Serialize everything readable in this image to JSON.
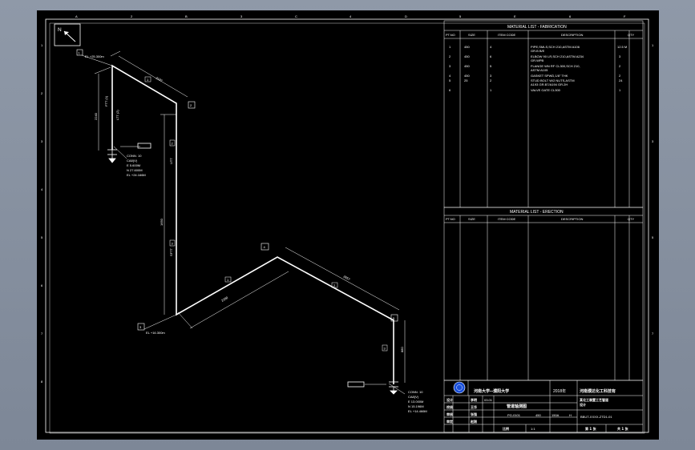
{
  "grid": {
    "top_letters": [
      "A",
      "B",
      "C",
      "D",
      "E",
      "F",
      "G",
      "H"
    ],
    "top_numbers": [
      "1",
      "2",
      "3",
      "4",
      "5",
      "6",
      "7",
      "8"
    ],
    "side_numbers": [
      "1",
      "2",
      "3",
      "4",
      "5",
      "6",
      "7",
      "8"
    ]
  },
  "north_arrow": "N",
  "fabrication": {
    "title": "MATERIAL LIST - FABRICATION",
    "headers": [
      "PT.NO",
      "SIZE",
      "ITEM CODE",
      "DESCRIPTION",
      "QTY"
    ],
    "rows": [
      {
        "pt": "1",
        "size": "450",
        "code": "4",
        "desc": "PIPE,SMLS,SCH 210,ASTM A106",
        "desc2": "GR.B B/E",
        "qty": "12.5 M"
      },
      {
        "pt": "2",
        "size": "450",
        "code": "6",
        "desc": "ELBOW 90 LR,SCH 210,ASTM A234",
        "desc2": "GR.WPB",
        "qty": "3"
      },
      {
        "pt": "3",
        "size": "450",
        "code": "5",
        "desc": "FLANGE WN RF CL300,SCH 210,",
        "desc2": "ASTM A105",
        "qty": "2"
      },
      {
        "pt": "4",
        "size": "450",
        "code": "3",
        "desc": "GASKET SPWD,1/8\" THK",
        "desc2": "",
        "qty": "2"
      },
      {
        "pt": "5",
        "size": "25",
        "code": "2",
        "desc": "STUD BOLT W/2 NUTS,ASTM",
        "desc2": "A193 GR.B7/A194 GR.2H",
        "qty": "24"
      },
      {
        "pt": "6",
        "size": "",
        "code": "1",
        "desc": "VALVE GATE CL300",
        "desc2": "",
        "qty": "1"
      }
    ]
  },
  "erection": {
    "title": "MATERIAL LIST - ERECTION",
    "headers": [
      "PT.NO",
      "SIZE",
      "ITEM CODE",
      "DESCRIPTION",
      "QTY"
    ]
  },
  "title_block": {
    "university": "河南大学--濮阳大学",
    "year": "2018年",
    "institute": "河南濮达化工科技有",
    "drawing_title": "管道轴测图",
    "project_line1": "某化工装置工艺管道",
    "project_line2": "设计",
    "line_no": "PG-0101",
    "size": "450",
    "spec": "150A",
    "insul": "H",
    "dwg_no": "BBUT-XXXX-ZTD1-01",
    "roles": [
      "设计",
      "校核",
      "审核",
      "审定"
    ],
    "names": [
      "李明",
      "王华",
      "张强",
      "赵刚"
    ],
    "dates": [
      "03.01",
      "",
      "",
      ""
    ],
    "scale_label": "比例",
    "scale": "1:1",
    "sheet_label": "第 1 张",
    "total_label": "共 1 张"
  },
  "iso": {
    "seg_top_diag": "2197",
    "seg_vertical": "1650",
    "seg_upper_vertical": "2240",
    "seg_lower_diag": "2280",
    "seg_right_diag": "2857",
    "seg_right_vertical": "880",
    "elev_top": "EL +25.300m",
    "elev_bottom_left": "EL +16.300m",
    "conn1_label": "CONN. 10",
    "conn1_l1": "CA8(V)",
    "conn1_l2": "E 5.600M",
    "conn1_l3": "N 27.600M",
    "conn1_l4": "EL +24.166M",
    "conn2_label": "CONN. 10",
    "conn2_l1": "CA8(V)",
    "conn2_l2": "E 13.000M",
    "conn2_l3": "N 15.196M",
    "conn2_l4": "EL +14.466M",
    "markers": [
      "1",
      "2",
      "3",
      "4",
      "5"
    ],
    "pt_tags": [
      "1",
      "2",
      "3",
      "1",
      "2",
      "3"
    ],
    "dir_labels": [
      "FTT (1)",
      "LTT (2)",
      "UTT",
      "SFTT"
    ]
  }
}
